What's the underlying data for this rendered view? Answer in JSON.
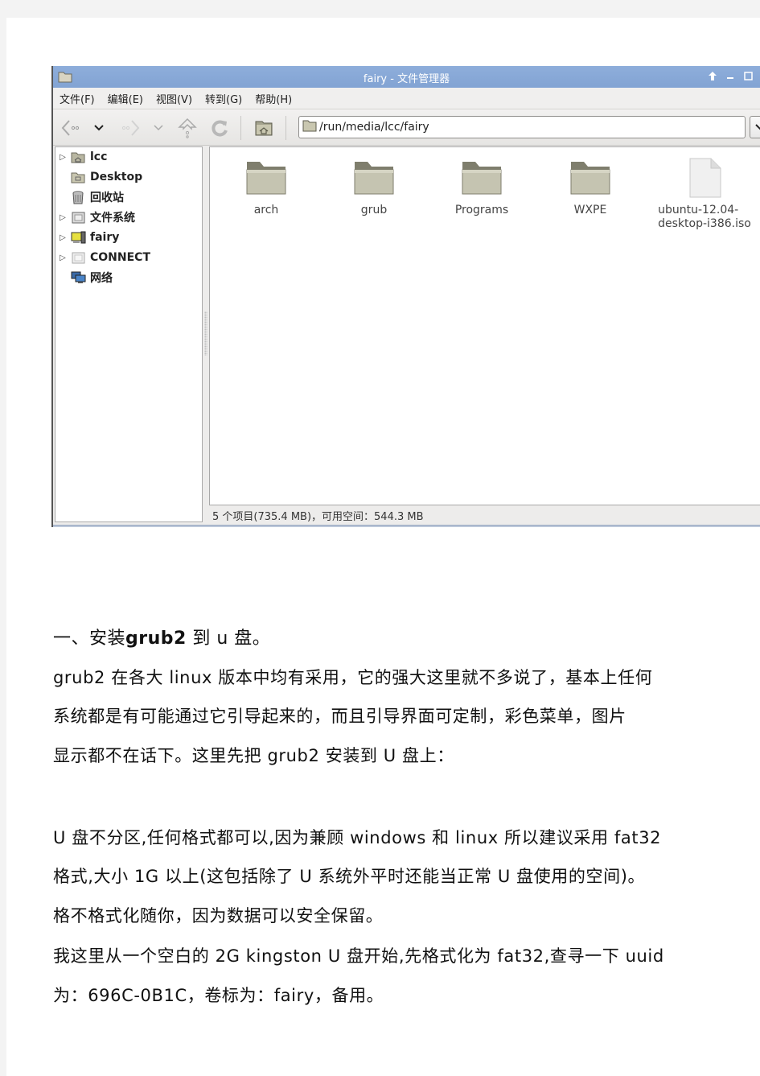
{
  "window": {
    "title": "fairy - 文件管理器",
    "menu": [
      "文件(F)",
      "编辑(E)",
      "视图(V)",
      "转到(G)",
      "帮助(H)"
    ],
    "location_path": "/run/media/lcc/fairy",
    "controls": {
      "restore_icon": "up-arrow-icon",
      "minimize_icon": "minimize-icon",
      "maximize_icon": "maximize-icon"
    },
    "toolbar_icons": [
      "back-icon",
      "back-history-icon",
      "forward-icon",
      "forward-history-icon",
      "up-icon",
      "reload-icon",
      "home-icon"
    ]
  },
  "sidebar": {
    "items": [
      {
        "label": "lcc",
        "icon": "home-folder-icon",
        "expandable": true
      },
      {
        "label": "Desktop",
        "icon": "desktop-folder-icon",
        "expandable": false
      },
      {
        "label": "回收站",
        "icon": "trash-icon",
        "expandable": false
      },
      {
        "label": "文件系统",
        "icon": "filesystem-icon",
        "expandable": true
      },
      {
        "label": "fairy",
        "icon": "usb-drive-icon",
        "expandable": true
      },
      {
        "label": "CONNECT",
        "icon": "drive-icon",
        "expandable": true
      },
      {
        "label": "网络",
        "icon": "network-icon",
        "expandable": false
      }
    ]
  },
  "files": [
    {
      "name": "arch",
      "type": "folder"
    },
    {
      "name": "grub",
      "type": "folder"
    },
    {
      "name": "Programs",
      "type": "folder"
    },
    {
      "name": "WXPE",
      "type": "folder"
    },
    {
      "name": "ubuntu-12.04-desktop-i386.iso",
      "name_line1": "ubuntu-12.04-",
      "name_line2": "desktop-i386.iso",
      "type": "file"
    }
  ],
  "status": "5 个项目(735.4 MB)，可用空间：544.3 MB",
  "document": {
    "heading_prefix": "一、安装",
    "heading_bold": "grub2",
    "heading_suffix": " 到 u 盘。",
    "lines": [
      "grub2 在各大 linux 版本中均有采用，它的强大这里就不多说了，基本上任何",
      "系统都是有可能通过它引导起来的，而且引导界面可定制，彩色菜单，图片",
      "显示都不在话下。这里先把 grub2 安装到 U 盘上：",
      "U 盘不分区,任何格式都可以,因为兼顾 windows 和 linux 所以建议采用 fat32",
      "格式,大小 1G 以上(这包括除了 U 系统外平时还能当正常 U 盘使用的空间)。",
      "格不格式化随你，因为数据可以安全保留。",
      "我这里从一个空白的 2G  kingston  U 盘开始,先格式化为 fat32,查寻一下 uuid",
      "为：696C-0B1C，卷标为：fairy，备用。"
    ]
  }
}
